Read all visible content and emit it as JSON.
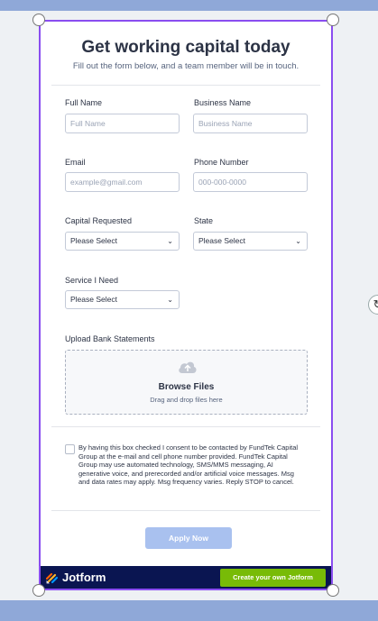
{
  "form": {
    "title": "Get working capital today",
    "subtitle": "Fill out the form below, and a team member will be in touch.",
    "fields": {
      "full_name": {
        "label": "Full Name",
        "placeholder": "Full Name"
      },
      "business_name": {
        "label": "Business Name",
        "placeholder": "Business Name"
      },
      "email": {
        "label": "Email",
        "placeholder": "example@gmail.com"
      },
      "phone": {
        "label": "Phone Number",
        "placeholder": "000-000-0000"
      },
      "capital": {
        "label": "Capital Requested",
        "value": "Please Select"
      },
      "state": {
        "label": "State",
        "value": "Please Select"
      },
      "service": {
        "label": "Service I Need",
        "value": "Please Select"
      }
    },
    "upload": {
      "label": "Upload Bank Statements",
      "browse": "Browse Files",
      "hint": "Drag and drop files here"
    },
    "consent": "By having this box checked I consent to be contacted by FundTek Capital Group at the e-mail and cell phone number provided. FundTek Capital Group may use automated technology, SMS/MMS messaging, AI generative voice, and prerecorded and/or artificial voice messages. Msg and data rates may apply. Msg frequency varies. Reply STOP to cancel.",
    "submit_label": "Apply Now"
  },
  "footer": {
    "brand": "Jotform",
    "cta": "Create your own Jotform"
  },
  "colors": {
    "selection": "#8a4df0",
    "submit": "#a9c1ef",
    "footer_bg": "#0a1551",
    "cta_bg": "#78bb07"
  }
}
